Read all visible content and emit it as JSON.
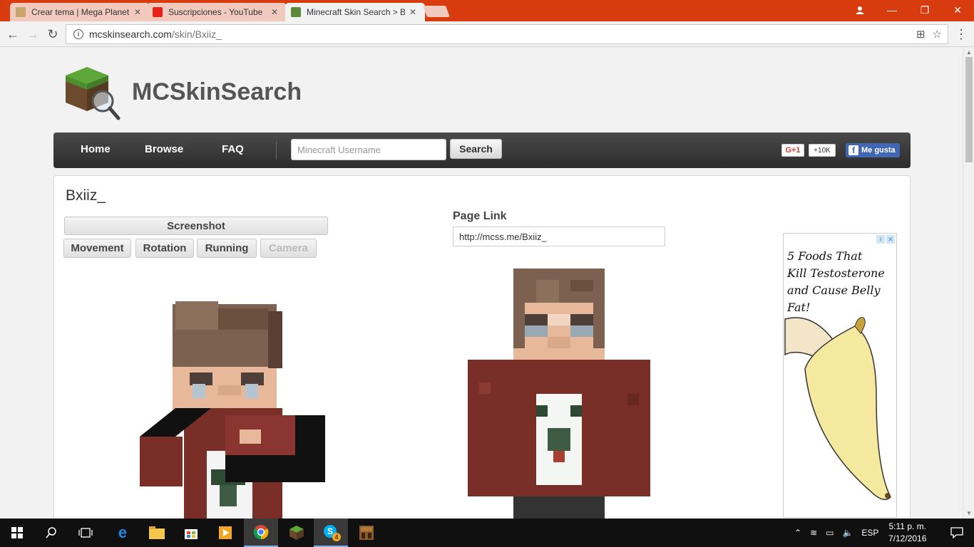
{
  "browser": {
    "tabs": [
      {
        "title": "Crear tema | Mega Planet",
        "active": false,
        "favicon_color": "#caa36a"
      },
      {
        "title": "Suscripciones - YouTube",
        "active": false,
        "favicon_color": "#e62117"
      },
      {
        "title": "Minecraft Skin Search > Bx",
        "active": true,
        "favicon_color": "#5d8a3a"
      }
    ],
    "url_host": "mcskinsearch.com",
    "url_path": "/skin/Bxiiz_",
    "icons": [
      "back-icon",
      "forward-icon",
      "reload-icon",
      "translate-icon",
      "star-icon",
      "user-icon",
      "minimize-icon",
      "restore-icon",
      "close-icon"
    ]
  },
  "site": {
    "title": "MCSkinSearch",
    "nav": {
      "home": "Home",
      "browse": "Browse",
      "faq": "FAQ"
    },
    "search_placeholder": "Minecraft Username",
    "search_button": "Search",
    "gplus_label": "G+1",
    "gplus_count": "+10K",
    "fb_like": "Me gusta"
  },
  "skin": {
    "name": "Bxiiz_",
    "screenshot_button": "Screenshot",
    "controls": [
      "Movement",
      "Rotation",
      "Running",
      "Camera"
    ],
    "page_link_label": "Page Link",
    "page_link": "http://mcss.me/Bxiiz_"
  },
  "ad": {
    "line1": "5 Foods That",
    "line2": "Kill Testosterone",
    "line3": "and Cause Belly Fat!"
  },
  "taskbar": {
    "language": "ESP",
    "time": "5:11 p. m.",
    "date": "7/12/2016",
    "skype_badge": "4"
  },
  "colors": {
    "chrome_accent": "#d83c0e",
    "nav_dark": "#333333",
    "sweater": "#7a2e28",
    "hair": "#7c6050",
    "skin": "#e8b89a"
  }
}
